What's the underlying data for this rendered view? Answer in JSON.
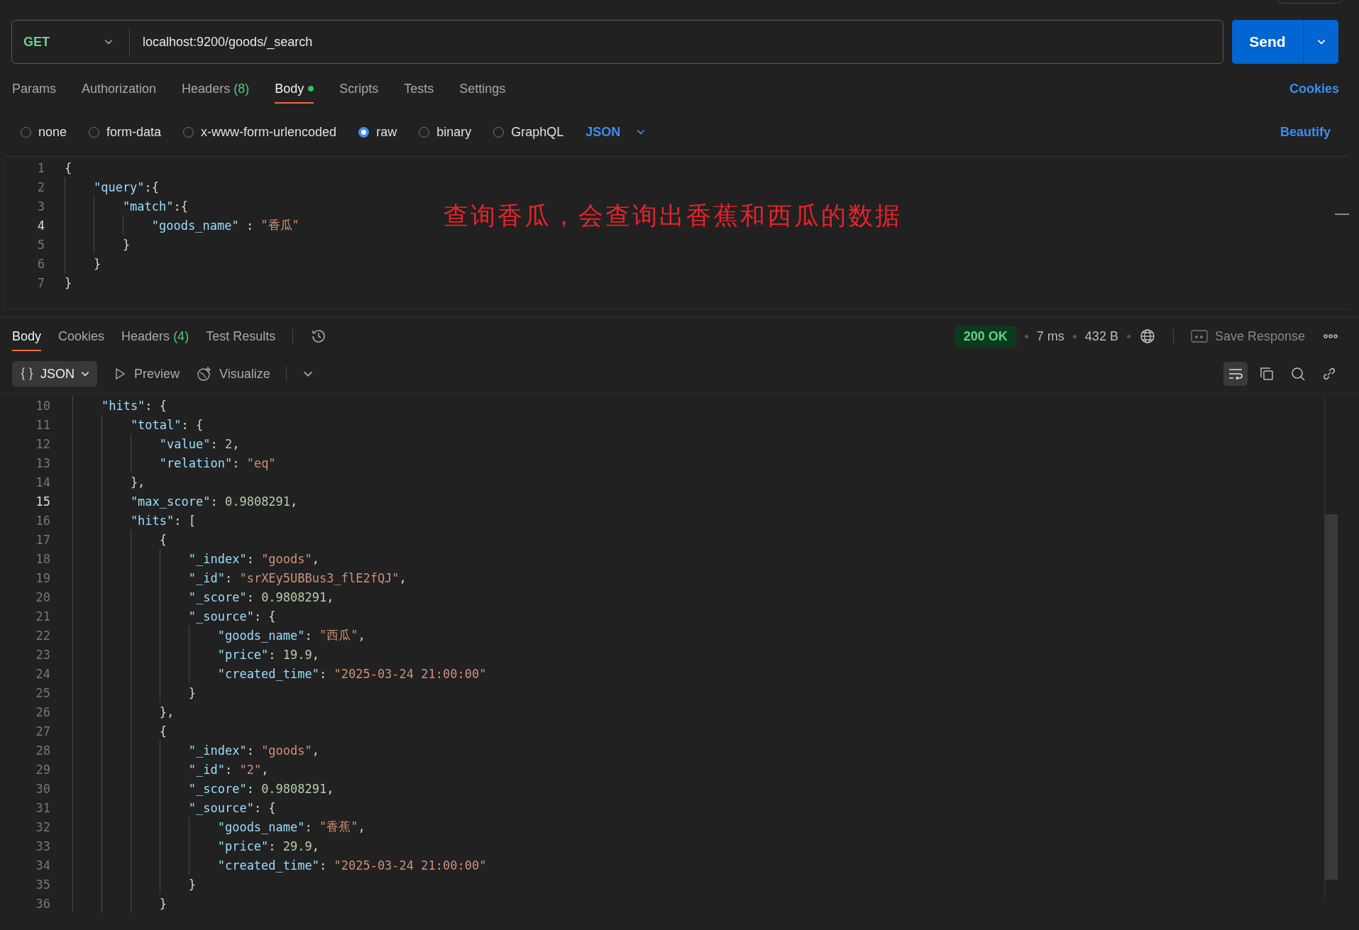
{
  "request": {
    "method": "GET",
    "url": "localhost:9200/goods/_search",
    "send_label": "Send"
  },
  "request_tabs": [
    {
      "label": "Params",
      "selected": false,
      "modified": false
    },
    {
      "label": "Authorization",
      "selected": false,
      "modified": false
    },
    {
      "label": "Headers",
      "count": "(8)",
      "selected": false,
      "modified": false
    },
    {
      "label": "Body",
      "selected": true,
      "modified": true
    },
    {
      "label": "Scripts",
      "selected": false,
      "modified": false
    },
    {
      "label": "Tests",
      "selected": false,
      "modified": false
    },
    {
      "label": "Settings",
      "selected": false,
      "modified": false
    }
  ],
  "cookies_link": "Cookies",
  "body_types": [
    {
      "label": "none",
      "selected": false
    },
    {
      "label": "form-data",
      "selected": false
    },
    {
      "label": "x-www-form-urlencoded",
      "selected": false
    },
    {
      "label": "raw",
      "selected": true
    },
    {
      "label": "binary",
      "selected": false
    },
    {
      "label": "GraphQL",
      "selected": false
    }
  ],
  "raw_format": "JSON",
  "beautify_link": "Beautify",
  "request_body": [
    {
      "n": "1",
      "text": "{",
      "current": false
    },
    {
      "n": "2",
      "text": "    \"query\":{",
      "current": false
    },
    {
      "n": "3",
      "text": "        \"match\":{",
      "current": false
    },
    {
      "n": "4",
      "text": "            \"goods_name\" : \"香瓜\"",
      "current": true
    },
    {
      "n": "5",
      "text": "        }",
      "current": false
    },
    {
      "n": "6",
      "text": "    }",
      "current": false
    },
    {
      "n": "7",
      "text": "}",
      "current": false
    }
  ],
  "annotation": "查询香瓜，会查询出香蕉和西瓜的数据",
  "response_tabs": [
    {
      "label": "Body",
      "selected": true
    },
    {
      "label": "Cookies",
      "selected": false
    },
    {
      "label": "Headers",
      "count": "(4)",
      "selected": false
    },
    {
      "label": "Test Results",
      "selected": false
    }
  ],
  "status": {
    "code": "200 OK",
    "time": "7 ms",
    "size": "432 B"
  },
  "save_response": "Save Response",
  "view_tabs": [
    {
      "label": "JSON",
      "kind": "dropdown"
    },
    {
      "label": "Preview",
      "kind": "preview"
    },
    {
      "label": "Visualize",
      "kind": "visualize"
    }
  ],
  "response_body": [
    {
      "n": "10",
      "text": "    \"hits\": {",
      "current": false
    },
    {
      "n": "11",
      "text": "        \"total\": {",
      "current": false
    },
    {
      "n": "12",
      "text": "            \"value\": 2,",
      "current": false
    },
    {
      "n": "13",
      "text": "            \"relation\": \"eq\"",
      "current": false
    },
    {
      "n": "14",
      "text": "        },",
      "current": false
    },
    {
      "n": "15",
      "text": "        \"max_score\": 0.9808291,",
      "current": true
    },
    {
      "n": "16",
      "text": "        \"hits\": [",
      "current": false
    },
    {
      "n": "17",
      "text": "            {",
      "current": false
    },
    {
      "n": "18",
      "text": "                \"_index\": \"goods\",",
      "current": false
    },
    {
      "n": "19",
      "text": "                \"_id\": \"srXEy5UBBus3_flE2fQJ\",",
      "current": false
    },
    {
      "n": "20",
      "text": "                \"_score\": 0.9808291,",
      "current": false
    },
    {
      "n": "21",
      "text": "                \"_source\": {",
      "current": false
    },
    {
      "n": "22",
      "text": "                    \"goods_name\": \"西瓜\",",
      "current": false
    },
    {
      "n": "23",
      "text": "                    \"price\": 19.9,",
      "current": false
    },
    {
      "n": "24",
      "text": "                    \"created_time\": \"2025-03-24 21:00:00\"",
      "current": false
    },
    {
      "n": "25",
      "text": "                }",
      "current": false
    },
    {
      "n": "26",
      "text": "            },",
      "current": false
    },
    {
      "n": "27",
      "text": "            {",
      "current": false
    },
    {
      "n": "28",
      "text": "                \"_index\": \"goods\",",
      "current": false
    },
    {
      "n": "29",
      "text": "                \"_id\": \"2\",",
      "current": false
    },
    {
      "n": "30",
      "text": "                \"_score\": 0.9808291,",
      "current": false
    },
    {
      "n": "31",
      "text": "                \"_source\": {",
      "current": false
    },
    {
      "n": "32",
      "text": "                    \"goods_name\": \"香蕉\",",
      "current": false
    },
    {
      "n": "33",
      "text": "                    \"price\": 29.9,",
      "current": false
    },
    {
      "n": "34",
      "text": "                    \"created_time\": \"2025-03-24 21:00:00\"",
      "current": false
    },
    {
      "n": "35",
      "text": "                }",
      "current": false
    },
    {
      "n": "36",
      "text": "            }",
      "current": false
    }
  ]
}
